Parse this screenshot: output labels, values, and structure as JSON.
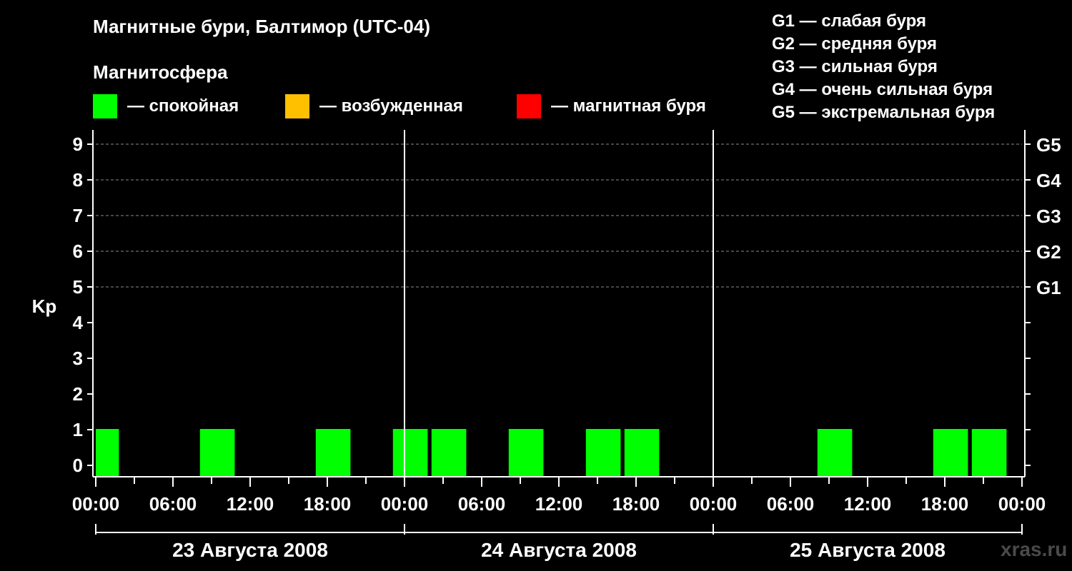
{
  "title": "Магнитные бури, Балтимор (UTC-04)",
  "magnetosphere_label": "Магнитосфера",
  "legend": [
    {
      "color": "#00ff00",
      "label": "— спокойная"
    },
    {
      "color": "#ffc000",
      "label": "— возбужденная"
    },
    {
      "color": "#ff0000",
      "label": "— магнитная буря"
    }
  ],
  "g_legend": [
    "G1 — слабая буря",
    "G2 — средняя буря",
    "G3 — сильная буря",
    "G4 — очень сильная буря",
    "G5 — экстремальная буря"
  ],
  "watermark": "xras.ru",
  "chart_data": {
    "type": "bar",
    "ylabel": "Kp",
    "ylim": [
      0,
      9
    ],
    "yticks": [
      "0",
      "1",
      "2",
      "3",
      "4",
      "5",
      "6",
      "7",
      "8",
      "9"
    ],
    "right_labels": [
      {
        "kp": 5,
        "label": "G1"
      },
      {
        "kp": 6,
        "label": "G2"
      },
      {
        "kp": 7,
        "label": "G3"
      },
      {
        "kp": 8,
        "label": "G4"
      },
      {
        "kp": 9,
        "label": "G5"
      }
    ],
    "xlim_hours": [
      0,
      72
    ],
    "xtick_labels": [
      "00:00",
      "06:00",
      "12:00",
      "18:00",
      "00:00",
      "06:00",
      "12:00",
      "18:00",
      "00:00",
      "06:00",
      "12:00",
      "18:00",
      "00:00"
    ],
    "days": [
      "23 Августа 2008",
      "24 Августа 2008",
      "25 Августа 2008"
    ],
    "grid": "dashed at 5,6,7,8,9",
    "color": "#00ff00",
    "bars": [
      {
        "start_hour": 0,
        "end_hour": 1.8,
        "kp": 1
      },
      {
        "start_hour": 8.1,
        "end_hour": 10.8,
        "kp": 1
      },
      {
        "start_hour": 17.1,
        "end_hour": 19.8,
        "kp": 1
      },
      {
        "start_hour": 23.1,
        "end_hour": 25.8,
        "kp": 1
      },
      {
        "start_hour": 26.1,
        "end_hour": 28.8,
        "kp": 1
      },
      {
        "start_hour": 32.1,
        "end_hour": 34.8,
        "kp": 1
      },
      {
        "start_hour": 38.1,
        "end_hour": 40.8,
        "kp": 1
      },
      {
        "start_hour": 41.1,
        "end_hour": 43.8,
        "kp": 1
      },
      {
        "start_hour": 56.1,
        "end_hour": 58.8,
        "kp": 1
      },
      {
        "start_hour": 65.1,
        "end_hour": 67.8,
        "kp": 1
      },
      {
        "start_hour": 68.1,
        "end_hour": 70.8,
        "kp": 1
      }
    ]
  }
}
